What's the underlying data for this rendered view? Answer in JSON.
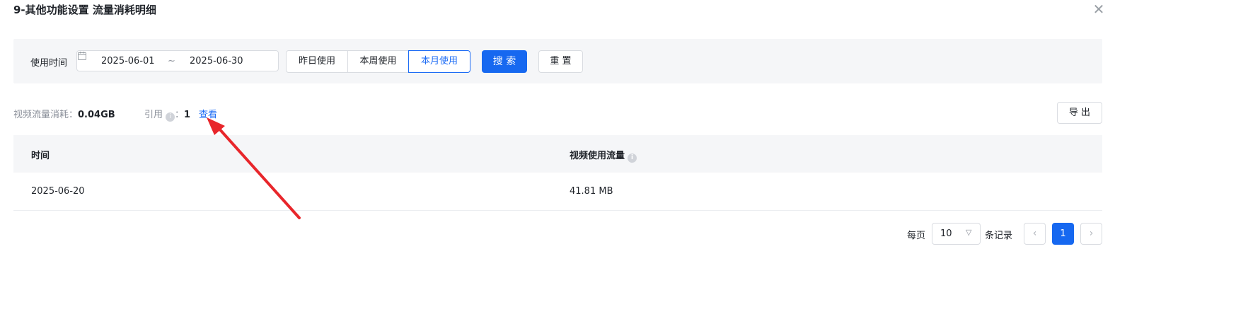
{
  "dialog": {
    "title": "9-其他功能设置 流量消耗明细",
    "close_glyph": "✕"
  },
  "filter": {
    "label": "使用时间",
    "start_date": "2025-06-01",
    "separator": "~",
    "end_date": "2025-06-30",
    "quick": [
      "昨日使用",
      "本周使用",
      "本月使用"
    ],
    "active_quick": "本月使用",
    "search_label": "搜 索",
    "reset_label": "重 置"
  },
  "summary": {
    "video_label": "视频流量消耗：",
    "video_value": "0.04GB",
    "ref_label": "引用",
    "ref_sep": "：",
    "ref_value": "1",
    "view_link": "查看",
    "export_label": "导 出"
  },
  "table": {
    "columns": [
      "时间",
      "视频使用流量"
    ],
    "rows": [
      {
        "time": "2025-06-20",
        "traffic": "41.81 MB"
      }
    ]
  },
  "pagination": {
    "per_page_label": "每页",
    "page_size": "10",
    "records_label": "条记录",
    "current_page": "1",
    "prev_glyph": "‹",
    "next_glyph": "›"
  },
  "colors": {
    "accent": "#1668f0",
    "annotation_arrow": "#e8262b"
  },
  "icons": {
    "info": "info-icon",
    "calendar": "calendar-icon",
    "chevron": "chevron-down-icon",
    "close": "close-icon"
  }
}
